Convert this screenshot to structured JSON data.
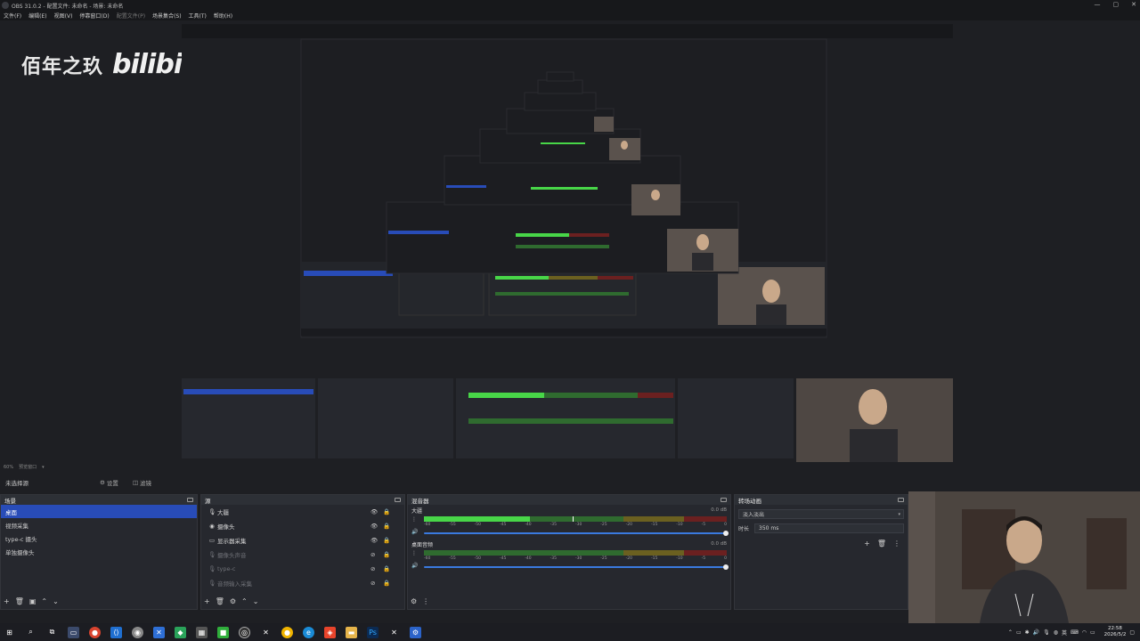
{
  "window": {
    "title": "OBS 31.0.2 - 配置文件: 未命名 - 场景: 未命名",
    "controls": [
      "—",
      "▢",
      "✕"
    ]
  },
  "menu": {
    "items": [
      "文件(F)",
      "编辑(E)",
      "视图(V)",
      "停靠窗口(D)",
      "配置文件(P)",
      "场景集合(S)",
      "工具(T)",
      "帮助(H)"
    ],
    "disabled_index": 4
  },
  "watermark": {
    "text": "佰年之玖",
    "logo": "bilibili"
  },
  "status": {
    "fps": "60%",
    "label": "预览窗口"
  },
  "scene_bar": {
    "no_scene": "未选择源",
    "properties": "设置",
    "filters": "滤镜"
  },
  "scenes": {
    "title": "场景",
    "items": [
      "桌面",
      "视频采集",
      "type-c 摄头",
      "单独摄像头"
    ],
    "selected": 0
  },
  "sources": {
    "title": "源",
    "items": [
      {
        "name": "大疆",
        "icon": "mic-icon",
        "visible": true,
        "dim": false
      },
      {
        "name": "摄像头",
        "icon": "camera-icon",
        "visible": true,
        "dim": false
      },
      {
        "name": "显示器采集",
        "icon": "monitor-icon",
        "visible": true,
        "dim": false
      },
      {
        "name": "摄像头声音",
        "icon": "mic-icon",
        "visible": false,
        "dim": true
      },
      {
        "name": "type-c",
        "icon": "mic-icon",
        "visible": false,
        "dim": true
      },
      {
        "name": "音频输入采集",
        "icon": "mic-icon",
        "visible": false,
        "dim": true
      }
    ]
  },
  "mixer": {
    "title": "混音器",
    "channels": [
      {
        "name": "大疆",
        "db": "0.0 dB",
        "level": 0.35,
        "peak": 0.49
      },
      {
        "name": "桌面音频",
        "db": "0.0 dB",
        "level": 0,
        "peak": 0
      }
    ],
    "ticks": [
      "-60",
      "-55",
      "-50",
      "-45",
      "-40",
      "-35",
      "-30",
      "-25",
      "-20",
      "-15",
      "-10",
      "-5",
      "0"
    ]
  },
  "transitions": {
    "title": "转场动画",
    "type": "淡入淡出",
    "duration_label": "时长",
    "duration": "350 ms"
  },
  "taskbar": {
    "time": "22:58",
    "date": "2026/5/2",
    "ime": "英",
    "apps": [
      "edge-icon",
      "chrome-icon",
      "vscode-icon",
      "obs-icon",
      "folder-icon",
      "photoshop-icon"
    ]
  },
  "colors": {
    "accent": "#284cb8",
    "bg": "#1e1f23",
    "dock": "#26282e",
    "meter_green": "#48d648"
  }
}
